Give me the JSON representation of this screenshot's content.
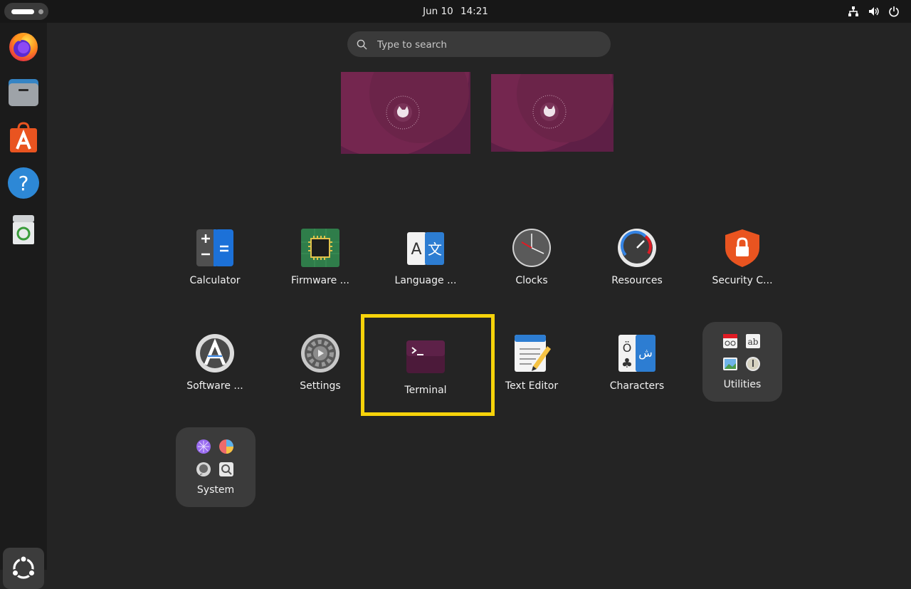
{
  "topbar": {
    "date": "Jun 10",
    "time": "14:21"
  },
  "search": {
    "placeholder": "Type to search"
  },
  "apps_row1": [
    {
      "label": "Calculator",
      "icon": "calculator-icon"
    },
    {
      "label": "Firmware ...",
      "icon": "firmware-icon"
    },
    {
      "label": "Language ...",
      "icon": "language-icon"
    },
    {
      "label": "Clocks",
      "icon": "clock-icon"
    },
    {
      "label": "Resources",
      "icon": "resources-gauge-icon"
    },
    {
      "label": "Security C...",
      "icon": "security-shield-icon"
    }
  ],
  "apps_row2": [
    {
      "label": "Software ...",
      "icon": "software-updater-icon"
    },
    {
      "label": "Settings",
      "icon": "settings-gear-icon"
    },
    {
      "label": "Terminal",
      "icon": "terminal-icon"
    },
    {
      "label": "Text Editor",
      "icon": "text-editor-icon"
    },
    {
      "label": "Characters",
      "icon": "characters-icon"
    }
  ],
  "folders": {
    "utilities": {
      "label": "Utilities"
    },
    "system": {
      "label": "System"
    }
  },
  "colors": {
    "accent": "#e95420",
    "highlight": "#f7d30a",
    "wallpaper": "#5e1f46",
    "background": "#242424"
  }
}
